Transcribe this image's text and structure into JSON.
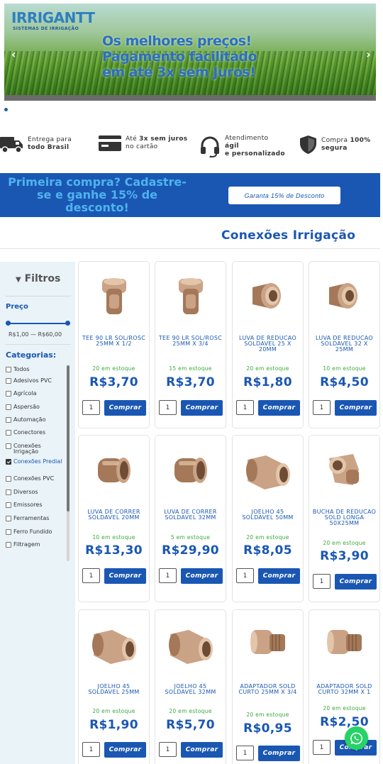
{
  "hero": {
    "logo": "IRRIGANTT",
    "logo_subtitle": "SISTEMAS DE IRRIGAÇÃO",
    "line1": "Os melhores preços!",
    "line2": "Pagamento facilitado",
    "line3": "em até 3x sem Juros!",
    "prev": "‹",
    "next": "›"
  },
  "benefits": [
    {
      "icon": "truck-icon",
      "line1": "Entrega para",
      "line2": "todo Brasil"
    },
    {
      "icon": "credit-card-icon",
      "line1_pre": "Até ",
      "line1_bold": "3x sem juros",
      "line2": "no cartão"
    },
    {
      "icon": "headset-icon",
      "line1": "Atendimento",
      "line2": "ágil",
      "line3": "e personalizado"
    },
    {
      "icon": "shield-icon",
      "line1_pre": "Compra ",
      "line1_bold": "100%",
      "line2": "segura"
    }
  ],
  "promo": {
    "text": "Primeira compra? Cadastre-se e ganhe 15% de desconto!",
    "button": "Garanta 15% de Desconto"
  },
  "category_title": "Conexões Irrigação",
  "sidebar": {
    "filters_label": "Filtros",
    "price_label": "Preço",
    "price_range": "R$1,00 — R$60,00",
    "categories_label": "Categorias:",
    "categories": [
      {
        "label": "Todos",
        "checked": false
      },
      {
        "label": "Adesivos PVC",
        "checked": false
      },
      {
        "label": "Agrícola",
        "checked": false
      },
      {
        "label": "Aspersão",
        "checked": false
      },
      {
        "label": "Automação",
        "checked": false
      },
      {
        "label": "Conectores",
        "checked": false
      },
      {
        "label": "Conexões Irrigação",
        "checked": false
      },
      {
        "label": "Conexões Predial",
        "checked": true
      },
      {
        "label": "Conexões PVC",
        "checked": false
      },
      {
        "label": "Diversos",
        "checked": false
      },
      {
        "label": "Emissores",
        "checked": false
      },
      {
        "label": "Ferramentas",
        "checked": false
      },
      {
        "label": "Ferro Fundido",
        "checked": false
      },
      {
        "label": "Filtragem",
        "checked": false
      }
    ]
  },
  "products": [
    {
      "name": "TEE 90 LR SOL/ROSC 25MM X 1/2",
      "stock": "20 em estoque",
      "price": "R$3,70",
      "qty": "1",
      "buy": "Comprar",
      "shape": "tee"
    },
    {
      "name": "TEE 90 LR SOL/ROSC 25MM X 3/4",
      "stock": "15 em estoque",
      "price": "R$3,70",
      "qty": "1",
      "buy": "Comprar",
      "shape": "tee"
    },
    {
      "name": "LUVA DE REDUCAO SOLDAVEL 25 X 20MM",
      "stock": "20 em estoque",
      "price": "R$1,80",
      "qty": "1",
      "buy": "Comprar",
      "shape": "reducer"
    },
    {
      "name": "LUVA DE REDUCAO SOLDAVEL 32 X 25MM",
      "stock": "10 em estoque",
      "price": "R$4,50",
      "qty": "1",
      "buy": "Comprar",
      "shape": "reducer"
    },
    {
      "name": "LUVA DE CORRER SOLDAVEL 20MM",
      "stock": "10 em estoque",
      "price": "R$13,30",
      "qty": "1",
      "buy": "Comprar",
      "shape": "sleeve"
    },
    {
      "name": "LUVA DE CORRER SOLDAVEL 32MM",
      "stock": "5 em estoque",
      "price": "R$29,90",
      "qty": "1",
      "buy": "Comprar",
      "shape": "sleeve"
    },
    {
      "name": "JOELHO 45 SOLDAVEL 50MM",
      "stock": "20 em estoque",
      "price": "R$8,05",
      "qty": "1",
      "buy": "Comprar",
      "shape": "elbow"
    },
    {
      "name": "BUCHA DE REDUCAO SOLD LONGA 50X25MM",
      "stock": "20 em estoque",
      "price": "R$3,90",
      "qty": "1",
      "buy": "Comprar",
      "shape": "bushing"
    },
    {
      "name": "JOELHO 45 SOLDAVEL 25MM",
      "stock": "20 em estoque",
      "price": "R$1,90",
      "qty": "1",
      "buy": "Comprar",
      "shape": "elbow"
    },
    {
      "name": "JOELHO 45 SOLDAVEL 32MM",
      "stock": "20 em estoque",
      "price": "R$5,70",
      "qty": "1",
      "buy": "Comprar",
      "shape": "elbow"
    },
    {
      "name": "ADAPTADOR SOLD CURTO 25MM X 3/4",
      "stock": "20 em estoque",
      "price": "R$0,95",
      "qty": "1",
      "buy": "Comprar",
      "shape": "adapter"
    },
    {
      "name": "ADAPTADOR SOLD CURTO 32MM X 1",
      "stock": "20 em estoque",
      "price": "R$2,50",
      "qty": "1",
      "buy": "Comprar",
      "shape": "adapter"
    }
  ],
  "colors": {
    "brand_blue": "#1a57b3",
    "stock_green": "#3aa83a",
    "promo_text": "#4fb3ee",
    "sidebar_bg": "#e9f3f8",
    "whatsapp": "#25d366"
  }
}
